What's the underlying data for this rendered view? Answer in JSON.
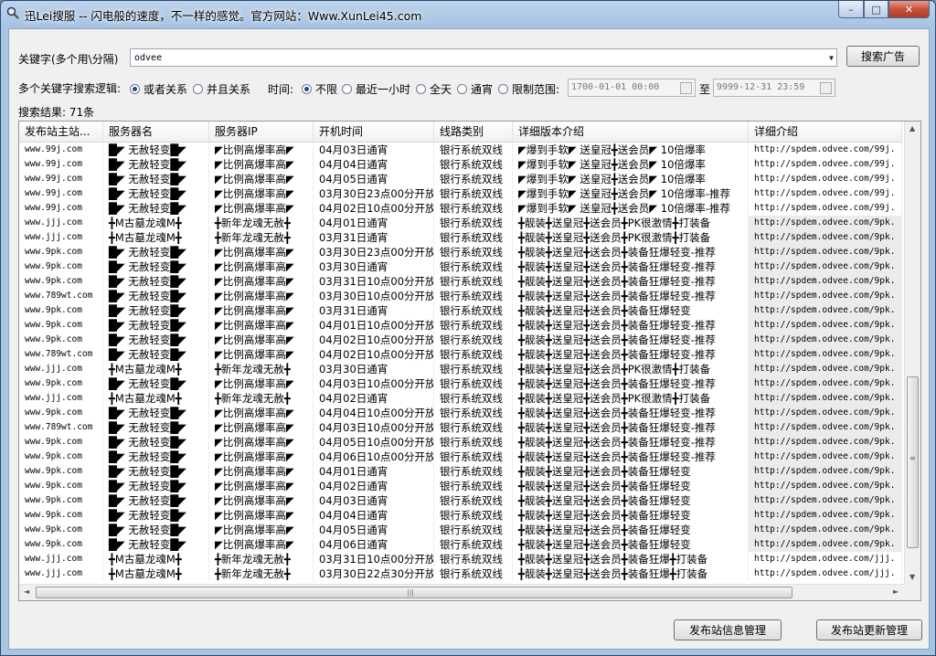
{
  "window": {
    "title": "迅Lei搜服 -- 闪电般的速度，不一样的感觉。官方网站：Www.XunLei45.com",
    "minimize": "–",
    "maximize": "□",
    "close": "✕"
  },
  "search": {
    "keyword_label": "关键字(多个用\\分隔)",
    "keyword_value": "odvee",
    "search_button": "搜索广告",
    "logic_label": "多个关键字搜索逻辑:",
    "logic_options": [
      "或者关系",
      "并且关系"
    ],
    "time_label": "时间:",
    "time_options": [
      "不限",
      "最近一小时",
      "全天",
      "通宵",
      "限制范围:"
    ],
    "date_from": "1700-01-01 00:00",
    "date_to_label": "至",
    "date_to": "9999-12-31 23:59",
    "result_label": "搜索结果: 71条"
  },
  "table": {
    "columns": [
      "发布站主站...",
      "服务器名",
      "服务器IP",
      "开机时间",
      "线路类别",
      "详细版本介绍",
      "详细介绍"
    ],
    "rows": [
      [
        "www.99j.com",
        "█◤ 无赦轻变█◤",
        "◤比例高爆率高◤",
        "04月03日通宵",
        "银行系统双线",
        "◤爆到手软◤ 送皇冠╋送会员◤ 10倍爆率",
        "http://spdem.odvee.com/99j.",
        false
      ],
      [
        "www.99j.com",
        "█◤ 无赦轻变█◤",
        "◤比例高爆率高◤",
        "04月04日通宵",
        "银行系统双线",
        "◤爆到手软◤ 送皇冠╋送会员◤ 10倍爆率",
        "http://spdem.odvee.com/99j.",
        false
      ],
      [
        "www.99j.com",
        "█◤ 无赦轻变█◤",
        "◤比例高爆率高◤",
        "04月05日通宵",
        "银行系统双线",
        "◤爆到手软◤ 送皇冠╋送会员◤ 10倍爆率",
        "http://spdem.odvee.com/99j.",
        false
      ],
      [
        "www.99j.com",
        "█◤ 无赦轻变█◤",
        "◤比例高爆率高◤",
        "03月30日23点00分开放",
        "银行系统双线",
        "◤爆到手软◤ 送皇冠╋送会员◤ 10倍爆率-推荐",
        "http://spdem.odvee.com/99j.",
        false
      ],
      [
        "www.99j.com",
        "█◤ 无赦轻变█◤",
        "◤比例高爆率高◤",
        "04月02日10点00分开放",
        "银行系统双线",
        "◤爆到手软◤ 送皇冠╋送会员◤ 10倍爆率-推荐",
        "http://spdem.odvee.com/99j.",
        false
      ],
      [
        "www.jjj.com",
        "╋M古墓龙魂M╋",
        "╋新年龙魂无赦╋",
        "04月01日通宵",
        "银行系统双线",
        "╋靓装╋送皇冠╋送会员╋PK很激情╋打装备",
        "http://spdem.odvee.com/9pk.",
        true
      ],
      [
        "www.jjj.com",
        "╋M古墓龙魂M╋",
        "╋新年龙魂无赦╋",
        "03月31日通宵",
        "银行系统双线",
        "╋靓装╋送皇冠╋送会员╋PK很激情╋打装备",
        "http://spdem.odvee.com/9pk.",
        true
      ],
      [
        "www.9pk.com",
        "█◤ 无赦轻变█◤",
        "◤比例高爆率高◤",
        "03月30日23点00分开放",
        "银行系统双线",
        "╋靓装╋送皇冠╋送会员╋装备狂爆轻变-推荐",
        "http://spdem.odvee.com/9pk.",
        true
      ],
      [
        "www.9pk.com",
        "█◤ 无赦轻变█◤",
        "◤比例高爆率高◤",
        "03月30日通宵",
        "银行系统双线",
        "╋靓装╋送皇冠╋送会员╋装备狂爆轻变-推荐",
        "http://spdem.odvee.com/9pk.",
        true
      ],
      [
        "www.9pk.com",
        "█◤ 无赦轻变█◤",
        "◤比例高爆率高◤",
        "03月31日10点00分开放",
        "银行系统双线",
        "╋靓装╋送皇冠╋送会员╋装备狂爆轻变-推荐",
        "http://spdem.odvee.com/9pk.",
        true
      ],
      [
        "www.789wt.com",
        "█◤ 无赦轻变█◤",
        "◤比例高爆率高◤",
        "03月30日10点00分开放",
        "银行系统双线",
        "╋靓装╋送皇冠╋送会员╋装备狂爆轻变-推荐",
        "http://spdem.odvee.com/9pk.",
        true
      ],
      [
        "www.9pk.com",
        "█◤ 无赦轻变█◤",
        "◤比例高爆率高◤",
        "03月31日通宵",
        "银行系统双线",
        "╋靓装╋送皇冠╋送会员╋装备狂爆轻变",
        "http://spdem.odvee.com/9pk.",
        true
      ],
      [
        "www.9pk.com",
        "█◤ 无赦轻变█◤",
        "◤比例高爆率高◤",
        "04月01日10点00分开放",
        "银行系统双线",
        "╋靓装╋送皇冠╋送会员╋装备狂爆轻变-推荐",
        "http://spdem.odvee.com/9pk.",
        true
      ],
      [
        "www.9pk.com",
        "█◤ 无赦轻变█◤",
        "◤比例高爆率高◤",
        "04月02日10点00分开放",
        "银行系统双线",
        "╋靓装╋送皇冠╋送会员╋装备狂爆轻变-推荐",
        "http://spdem.odvee.com/9pk.",
        true
      ],
      [
        "www.789wt.com",
        "█◤ 无赦轻变█◤",
        "◤比例高爆率高◤",
        "04月02日10点00分开放",
        "银行系统双线",
        "╋靓装╋送皇冠╋送会员╋装备狂爆轻变-推荐",
        "http://spdem.odvee.com/9pk.",
        true
      ],
      [
        "www.jjj.com",
        "╋M古墓龙魂M╋",
        "╋新年龙魂无赦╋",
        "03月30日通宵",
        "银行系统双线",
        "╋靓装╋送皇冠╋送会员╋PK很激情╋打装备",
        "http://spdem.odvee.com/9pk.",
        true
      ],
      [
        "www.9pk.com",
        "█◤ 无赦轻变█◤",
        "◤比例高爆率高◤",
        "04月03日10点00分开放",
        "银行系统双线",
        "╋靓装╋送皇冠╋送会员╋装备狂爆轻变-推荐",
        "http://spdem.odvee.com/9pk.",
        true
      ],
      [
        "www.jjj.com",
        "╋M古墓龙魂M╋",
        "╋新年龙魂无赦╋",
        "04月02日通宵",
        "银行系统双线",
        "╋靓装╋送皇冠╋送会员╋PK很激情╋打装备",
        "http://spdem.odvee.com/9pk.",
        true
      ],
      [
        "www.9pk.com",
        "█◤ 无赦轻变█◤",
        "◤比例高爆率高◤",
        "04月04日10点00分开放",
        "银行系统双线",
        "╋靓装╋送皇冠╋送会员╋装备狂爆轻变-推荐",
        "http://spdem.odvee.com/9pk.",
        true
      ],
      [
        "www.789wt.com",
        "█◤ 无赦轻变█◤",
        "◤比例高爆率高◤",
        "04月03日10点00分开放",
        "银行系统双线",
        "╋靓装╋送皇冠╋送会员╋装备狂爆轻变-推荐",
        "http://spdem.odvee.com/9pk.",
        true
      ],
      [
        "www.9pk.com",
        "█◤ 无赦轻变█◤",
        "◤比例高爆率高◤",
        "04月05日10点00分开放",
        "银行系统双线",
        "╋靓装╋送皇冠╋送会员╋装备狂爆轻变-推荐",
        "http://spdem.odvee.com/9pk.",
        true
      ],
      [
        "www.9pk.com",
        "█◤ 无赦轻变█◤",
        "◤比例高爆率高◤",
        "04月06日10点00分开放",
        "银行系统双线",
        "╋靓装╋送皇冠╋送会员╋装备狂爆轻变-推荐",
        "http://spdem.odvee.com/9pk.",
        true
      ],
      [
        "www.9pk.com",
        "█◤ 无赦轻变█◤",
        "◤比例高爆率高◤",
        "04月01日通宵",
        "银行系统双线",
        "╋靓装╋送皇冠╋送会员╋装备狂爆轻变",
        "http://spdem.odvee.com/9pk.",
        true
      ],
      [
        "www.9pk.com",
        "█◤ 无赦轻变█◤",
        "◤比例高爆率高◤",
        "04月02日通宵",
        "银行系统双线",
        "╋靓装╋送皇冠╋送会员╋装备狂爆轻变",
        "http://spdem.odvee.com/9pk.",
        true
      ],
      [
        "www.9pk.com",
        "█◤ 无赦轻变█◤",
        "◤比例高爆率高◤",
        "04月03日通宵",
        "银行系统双线",
        "╋靓装╋送皇冠╋送会员╋装备狂爆轻变",
        "http://spdem.odvee.com/9pk.",
        true
      ],
      [
        "www.9pk.com",
        "█◤ 无赦轻变█◤",
        "◤比例高爆率高◤",
        "04月04日通宵",
        "银行系统双线",
        "╋靓装╋送皇冠╋送会员╋装备狂爆轻变",
        "http://spdem.odvee.com/9pk.",
        true
      ],
      [
        "www.9pk.com",
        "█◤ 无赦轻变█◤",
        "◤比例高爆率高◤",
        "04月05日通宵",
        "银行系统双线",
        "╋靓装╋送皇冠╋送会员╋装备狂爆轻变",
        "http://spdem.odvee.com/9pk.",
        true
      ],
      [
        "www.9pk.com",
        "█◤ 无赦轻变█◤",
        "◤比例高爆率高◤",
        "04月06日通宵",
        "银行系统双线",
        "╋靓装╋送皇冠╋送会员╋装备狂爆轻变",
        "http://spdem.odvee.com/9pk.",
        true
      ],
      [
        "www.jjj.com",
        "╋M古墓龙魂M╋",
        "╋新年龙魂无赦╋",
        "03月31日10点00分开放",
        "银行系统双线",
        "╋靓装╋送皇冠╋送会员╋装备狂爆╋打装备",
        "http://spdem.odvee.com/jjj.",
        false
      ],
      [
        "www.jjj.com",
        "╋M古墓龙魂M╋",
        "╋新年龙魂无赦╋",
        "03月30日22点30分开放",
        "银行系统双线",
        "╋靓装╋送皇冠╋送会员╋装备狂爆╋打装备",
        "http://spdem.odvee.com/jjj.",
        false
      ]
    ]
  },
  "footer": {
    "btn_info": "发布站信息管理",
    "btn_update": "发布站更新管理"
  },
  "icons": {
    "scroll_up": "▲",
    "scroll_down": "▼",
    "scroll_left": "◄",
    "scroll_right": "►",
    "grip_v": "≡",
    "grip_h": "|||",
    "combo_arrow": "▼"
  }
}
